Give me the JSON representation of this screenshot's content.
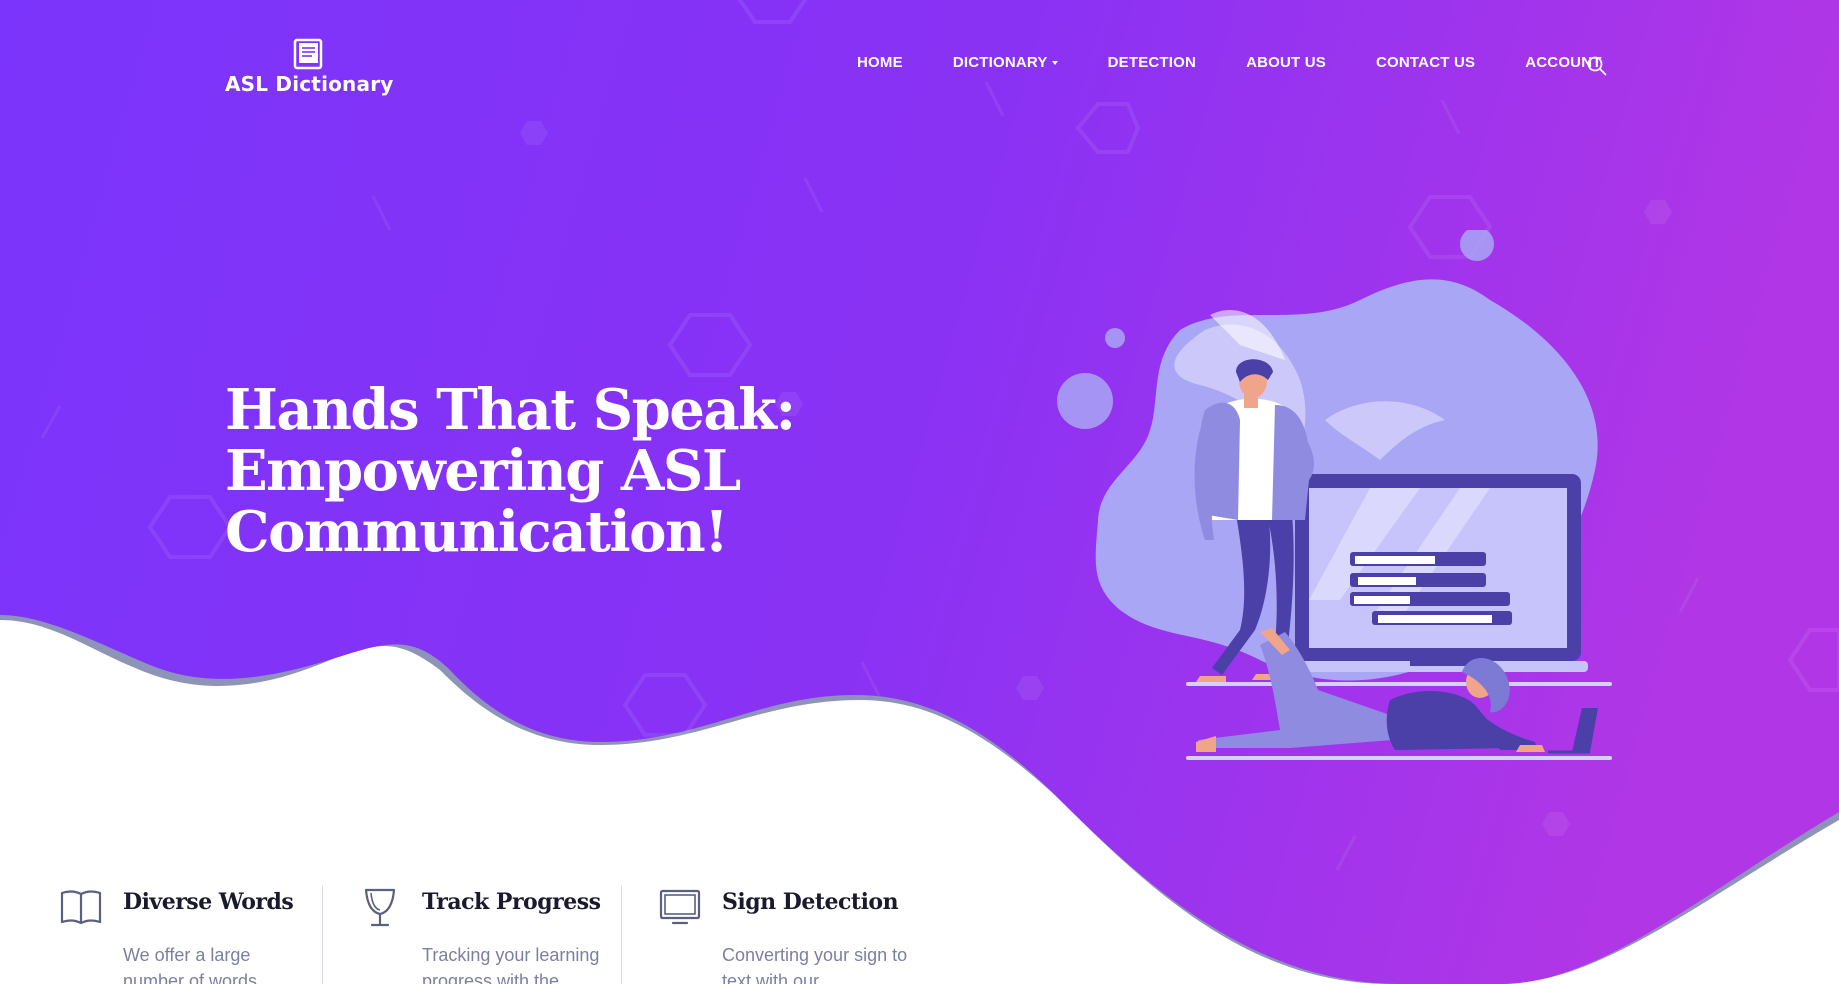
{
  "header": {
    "logo_text": "ASL Dictionary",
    "logo_icon": "book-icon",
    "nav": [
      {
        "label": "HOME",
        "has_dropdown": false
      },
      {
        "label": "DICTIONARY",
        "has_dropdown": true
      },
      {
        "label": "DETECTION",
        "has_dropdown": false
      },
      {
        "label": "ABOUT US",
        "has_dropdown": false
      },
      {
        "label": "CONTACT US",
        "has_dropdown": false
      },
      {
        "label": "ACCOUNT",
        "has_dropdown": false
      }
    ],
    "search_icon": "search-icon"
  },
  "hero": {
    "headline_lines": [
      "Hands That Speak:",
      "Empowering ASL",
      "Communication!"
    ],
    "gradient_start": "#7b34fb",
    "gradient_end": "#b136e6",
    "illustration": "people-with-laptop-illustration"
  },
  "features": [
    {
      "icon": "open-book-icon",
      "title": "Diverse Words",
      "description": "We offer a large number of words"
    },
    {
      "icon": "trophy-icon",
      "title": "Track Progress",
      "description": "Tracking your learning progress with the"
    },
    {
      "icon": "monitor-icon",
      "title": "Sign Detection",
      "description": "Converting your sign to text with our"
    }
  ],
  "colors": {
    "accent": "#7b34fb",
    "wave_shadow": "#8e94b8",
    "illustration_light": "#a9a6f5",
    "illustration_dark": "#4b3fa8",
    "feature_title": "#1a1a2e",
    "feature_text": "#7b80a0"
  }
}
